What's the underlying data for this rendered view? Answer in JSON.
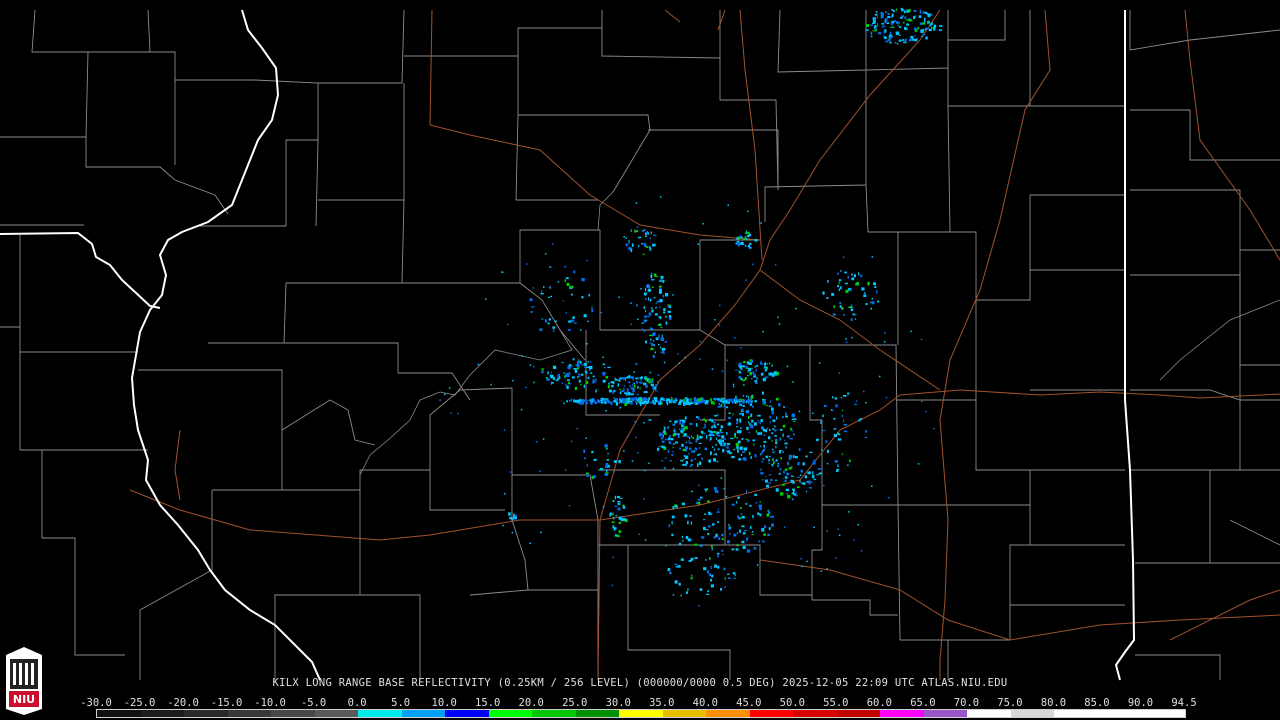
{
  "product": {
    "title": "KILX LONG RANGE BASE REFLECTIVITY (0.25KM / 256 LEVEL) (000000/0000 0.5 DEG) 2025-12-05 22:09 UTC  ATLAS.NIU.EDU"
  },
  "logo": {
    "text": "NIU",
    "color": "#c8102e"
  },
  "colorbar": {
    "labels": [
      "-30.0",
      "-25.0",
      "-20.0",
      "-15.0",
      "-10.0",
      "-5.0",
      "0.0",
      "5.0",
      "10.0",
      "15.0",
      "20.0",
      "25.0",
      "30.0",
      "35.0",
      "40.0",
      "45.0",
      "50.0",
      "55.0",
      "60.0",
      "65.0",
      "70.0",
      "75.0",
      "80.0",
      "85.0",
      "90.0",
      "94.5"
    ],
    "colors": [
      "#101010",
      "#1c1c1c",
      "#2a2a2a",
      "#383838",
      "#484848",
      "#5a5a5a",
      "#00ecec",
      "#00a0f6",
      "#0000f6",
      "#00ff00",
      "#00c800",
      "#009000",
      "#ffff00",
      "#e7c000",
      "#ff9000",
      "#ff0000",
      "#d60000",
      "#c00000",
      "#ff00ff",
      "#9955c9",
      "#ffffff",
      "#d8d8d8",
      "#ffffff",
      "#ffffff",
      "#ffffff"
    ]
  },
  "map_colors": {
    "background": "#000000",
    "county_lines": "#8c8c8c",
    "state_lines": "#ffffff",
    "highways": "#a0522d",
    "echo_light": "#00c8ff",
    "echo_medium": "#0070f0",
    "echo_strong": "#00d000"
  }
}
